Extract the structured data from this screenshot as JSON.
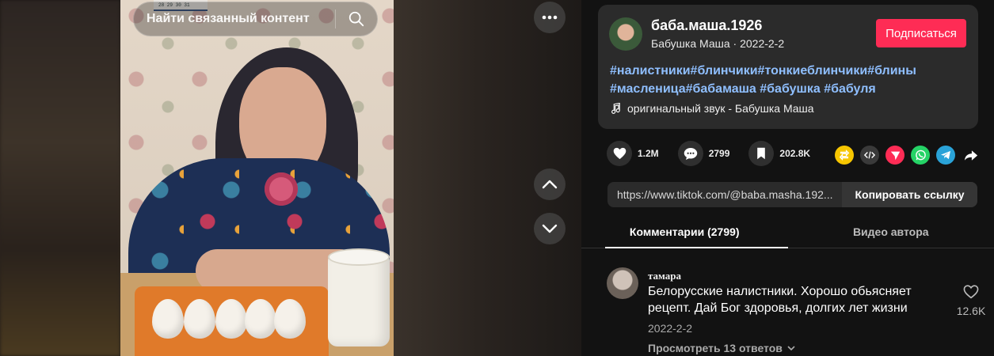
{
  "search": {
    "placeholder": "Найти связанный контент"
  },
  "video": {
    "calendar_text": "28 29 30 31"
  },
  "author": {
    "username": "баба.маша.1926",
    "subline": "Бабушка Маша · 2022-2-2",
    "follow_label": "Подписаться",
    "hashtags": "#налистники#блинчики#тонкиеблинчики#блины #масленица#бабамаша #бабушка #бабуля",
    "sound": "оригинальный звук - Бабушка Маша"
  },
  "actions": {
    "likes": "1.2M",
    "comments": "2799",
    "saves": "202.8K"
  },
  "share": {
    "icons": [
      "repost-icon",
      "embed-icon",
      "send-icon",
      "whatsapp-icon",
      "telegram-icon",
      "share-arrow-icon"
    ],
    "colors": {
      "repost": "#f7c600",
      "embed": "#3a3a3a",
      "send": "#fe2c55",
      "whatsapp": "#25d366",
      "telegram": "#2aa3d8"
    }
  },
  "link": {
    "url": "https://www.tiktok.com/@baba.masha.192...",
    "copy_label": "Копировать ссылку"
  },
  "tabs": [
    {
      "label": "Комментарии (2799)",
      "active": true
    },
    {
      "label": "Видео автора",
      "active": false
    }
  ],
  "comment": {
    "name": "тамара",
    "text": "Белорусские налистники. Хорошо обьясняет рецепт. Дай Бог здоровья, долгих лет жизни",
    "date": "2022-2-2",
    "replies": "Просмотреть 13 ответов",
    "likes": "12.6K"
  },
  "colors": {
    "accent": "#fe2c55",
    "hashtag": "#8fbfff",
    "background": "#121212"
  }
}
